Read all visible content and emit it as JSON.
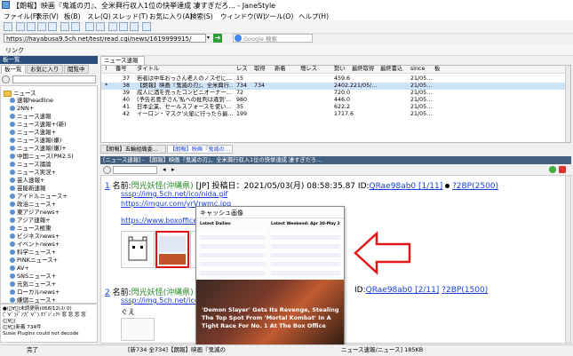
{
  "window": {
    "title": "【朗報】映画『鬼滅の刃』、全米興行収入1位の快挙達成 凄すぎだろ... - JaneStyle"
  },
  "menu": [
    "ファイル(F)",
    "表示(V)",
    "板(B)",
    "スレ(Q)",
    "スレッド(T)",
    "お気に入り(A)",
    "検索(S)",
    "ウィンドウ(W)",
    "ツール(O)",
    "ヘルプ(H)"
  ],
  "address": {
    "url": "https://hayabusa9.5ch.net/test/read.cgi/news/1619999915/",
    "search_placeholder": "Google 検索"
  },
  "link_bar": {
    "label": "リンク"
  },
  "left_pane": {
    "title": "板一覧",
    "tabs": [
      "板一覧",
      "お気に入り",
      "閲覧中"
    ],
    "root": "ニュース",
    "items": [
      "速報headline",
      "2NN+",
      "ニュース速報",
      "ニュース速報+(新)",
      "ニュース速報+",
      "ニュース速報(嫌)",
      "ニュース速報(嫌)+",
      "中国ニュース(PM2.5)",
      "ニュース議論",
      "ニュース実況+",
      "芸人速報+",
      "芸能新速報",
      "アイドルニュース+",
      "政治ニュース+",
      "東アジアnews+",
      "アジア速報+",
      "ニュース極東",
      "ビジネスnews+",
      "イベントnews+",
      "科学ニュース+",
      "PINKニュース+",
      "AV+",
      "SNSニュース+",
      "元気ニュース+",
      "ローカルnews+",
      "嫌儲ニュース+"
    ],
    "status_lines": [
      "●(ﾟ∀ﾟ)未読更新(068/12ﾚｽ/ 0)",
      "(ﾟ∀ﾟ)ﾃﾞﾝﾜ(ﾟ∀ﾟ) ｵﾌﾞｼﾞｪｸﾄ 窓 窓 窓 窓",
      "(ﾟ∀ﾟ)",
      "(ﾟ∀ﾟ)新着 734件",
      "Susie Plugins could not decode"
    ]
  },
  "thread_list": {
    "tab": "ニュース速報",
    "columns": [
      "!",
      "番号",
      "タイトル",
      "レス",
      "取得",
      "新着",
      "増レス",
      "勢い",
      "最終取得",
      "最終書込",
      "since",
      "板"
    ],
    "rows": [
      {
        "mark": "",
        "num": "37",
        "title": "若者は中年おっさん老人のノスゼに…",
        "res": "15",
        "get": "",
        "new": "",
        "inc": "",
        "momentum": "459.6",
        "last_get": "",
        "last_post": "",
        "since": "21/05…",
        "board": ""
      },
      {
        "mark": "*",
        "num": "38",
        "title": "【朗報】映画『鬼滅の刃』、全米興行…",
        "res": "734",
        "get": "734",
        "new": "",
        "inc": "",
        "momentum": "2402.2",
        "last_get": "21/05/…",
        "last_post": "",
        "since": "21/05…",
        "board": ""
      },
      {
        "mark": "",
        "num": "39",
        "title": "成人に酒を売ったコンビニオーナー…",
        "res": "72",
        "get": "",
        "new": "",
        "inc": "",
        "momentum": "720.0",
        "last_get": "",
        "last_post": "",
        "since": "21/05…",
        "board": ""
      },
      {
        "mark": "",
        "num": "40",
        "title": "(予告名菅子さん'私への批判は違到'…",
        "res": "980",
        "get": "",
        "new": "",
        "inc": "",
        "momentum": "446.0",
        "last_get": "",
        "last_post": "",
        "since": "21/05…",
        "board": ""
      },
      {
        "mark": "",
        "num": "41",
        "title": "日本企業、セールスフォースを使い…",
        "res": "35",
        "get": "",
        "new": "",
        "inc": "",
        "momentum": "622.2",
        "last_get": "",
        "last_post": "",
        "since": "21/05…",
        "board": ""
      },
      {
        "mark": "",
        "num": "42",
        "title": "イーロン・マスク'火星に行ったら最…",
        "res": "199",
        "get": "",
        "new": "",
        "inc": "",
        "momentum": "1717.6",
        "last_get": "",
        "last_post": "",
        "since": "21/05…",
        "board": ""
      }
    ]
  },
  "thread_tabs": [
    "【朗報】五輪組織委…",
    "【朗報】映画『鬼滅の…"
  ],
  "thread": {
    "title_bar": "[ニュース速報] - 【朗報】映画『鬼滅の刃』、全米興行収入1位の快挙達成 凄すぎだろ…",
    "posts": [
      {
        "num": "1",
        "name_label": "名前:",
        "name": "閃光妖怪(沖縄県)",
        "flag": "[JP]",
        "date": "投稿日：2021/05/03(月) 08:58:35.87",
        "id_label": "ID:",
        "id": "QRae98ab0 [1/11]",
        "be": "?2BP(2500)",
        "links": [
          "sssp://img.5ch.net/ico/nida.gif",
          "https://imgur.com/yrVrwmc.jpg",
          "https://www.boxofficemojo.com/"
        ]
      },
      {
        "num": "2",
        "name_label": "名前:",
        "name": "閃光妖怪(沖縄県)",
        "flag": "",
        "date": "",
        "id_label": "ID:",
        "id": "QRae98ab0 [2/11]",
        "be": "?2BP(1500)",
        "links": [
          "sssp://img.5ch.net/ico/nida.gif"
        ],
        "body": "ぐえ"
      }
    ]
  },
  "popup": {
    "title": "キャッシュ画像",
    "table_headers": [
      "Latest Dailies",
      "Latest Weekend: Apr 30-May 2"
    ],
    "caption": "'Demon Slayer' Gets Its Revenge, Stealing The Top Spot From 'Mortal Kombat' In A Tight Race For No. 1 At The Box Office"
  },
  "status_bar": {
    "left": "完了",
    "middle": "[新734 全734]【朗報】映画『鬼滅の",
    "right": "ニュース速報/ニュース] 185KB"
  }
}
